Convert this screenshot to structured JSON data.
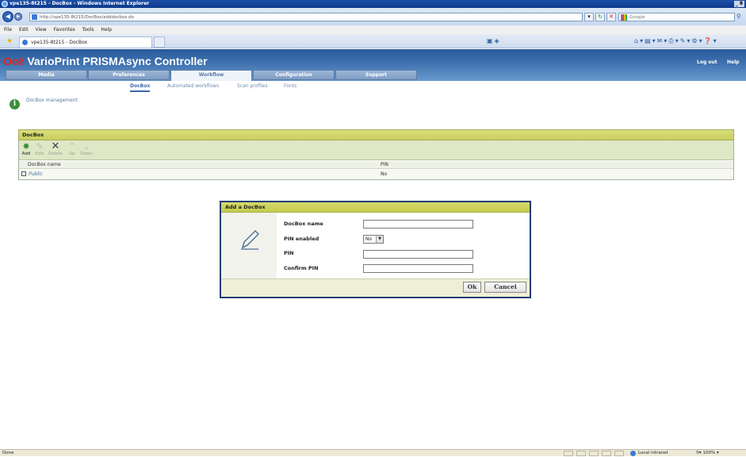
{
  "window": {
    "title": "vpe135-8t215 - DocBox - Windows Internet Explorer",
    "controls": "_ 8"
  },
  "browser": {
    "address": "http://vpe135-8t215/DocBox/adddocbox.do",
    "search_placeholder": "Google",
    "menu": [
      "File",
      "Edit",
      "View",
      "Favorites",
      "Tools",
      "Help"
    ],
    "tab_title": "vpe135-8t215 - DocBox"
  },
  "app": {
    "brand_prefix": "Océ",
    "brand_name": "VarioPrint PRISMAsync Controller",
    "logout": "Log out",
    "help": "Help",
    "main_tabs": [
      "Media",
      "Preferences",
      "Workflow",
      "Configuration",
      "Support"
    ],
    "active_main_tab": "Workflow",
    "sub_tabs": [
      "DocBox",
      "Automated workflows",
      "Scan profiles",
      "Fonts"
    ],
    "active_sub_tab": "DocBox",
    "info_text": "DocBox management"
  },
  "panel": {
    "title": "DocBox",
    "toolbar": {
      "add": "Add",
      "edit": "Edit",
      "delete": "Delete",
      "up": "Up",
      "down": "Down"
    },
    "columns": {
      "name": "DocBox name",
      "pin": "PIN"
    },
    "rows": [
      {
        "name": "Public",
        "pin": "No"
      }
    ]
  },
  "dialog": {
    "title": "Add a DocBox",
    "fields": {
      "name_label": "DocBox name",
      "name_value": "",
      "pin_enabled_label": "PIN enabled",
      "pin_enabled_value": "No",
      "pin_label": "PIN",
      "pin_value": "",
      "confirm_label": "Confirm PIN",
      "confirm_value": ""
    },
    "ok": "Ok",
    "cancel": "Cancel"
  },
  "status": {
    "left": "Done",
    "zone": "Local intranet",
    "zoom": "100%"
  },
  "colors": {
    "header_blue": "#3f72b0",
    "panel_olive": "#c9cf5d",
    "dialog_border": "#1e3f75",
    "brand_red": "#e4231b"
  }
}
